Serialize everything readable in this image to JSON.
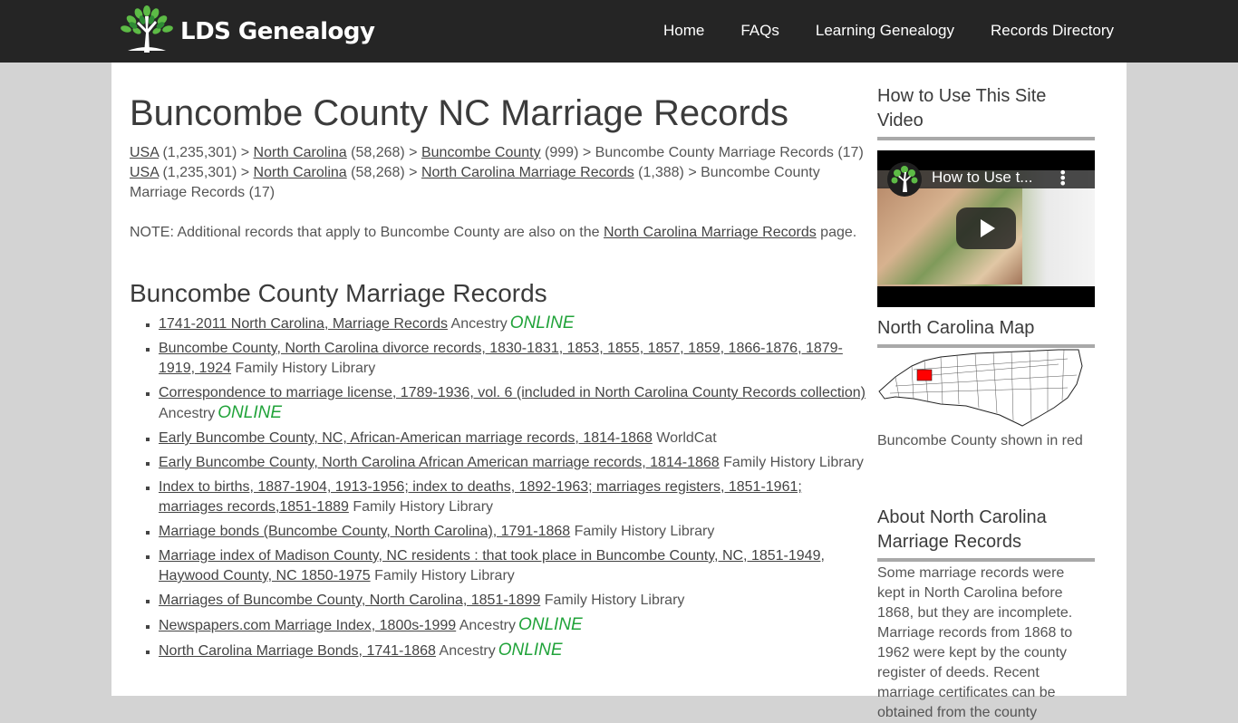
{
  "site": {
    "logo_text": "LDS Genealogy",
    "nav": [
      {
        "label": "Home"
      },
      {
        "label": "FAQs"
      },
      {
        "label": "Learning Genealogy"
      },
      {
        "label": "Records Directory"
      }
    ]
  },
  "main": {
    "title": "Buncombe County NC Marriage Records",
    "breadcrumbs": [
      {
        "items": [
          {
            "link": "USA",
            "count": " (1,235,301) > "
          },
          {
            "link": "North Carolina",
            "count": " (58,268) > "
          },
          {
            "link": "Buncombe County",
            "count": " (999) > Buncombe County Marriage Records (17)"
          }
        ]
      },
      {
        "items": [
          {
            "link": "USA",
            "count": " (1,235,301) > "
          },
          {
            "link": "North Carolina",
            "count": " (58,268) > "
          },
          {
            "link": "North Carolina Marriage Records",
            "count": " (1,388) > Buncombe County Marriage Records (17)"
          }
        ]
      }
    ],
    "note": {
      "prefix": "NOTE: Additional records that apply to Buncombe County are also on the ",
      "link": "North Carolina Marriage Records",
      "suffix": " page."
    },
    "section_title": "Buncombe County Marriage Records",
    "online_label": "ONLINE",
    "records": [
      {
        "title": "1741-2011 North Carolina, Marriage Records",
        "source": "Ancestry",
        "online": true
      },
      {
        "title": "Buncombe County, North Carolina divorce records, 1830-1831, 1853, 1855, 1857, 1859, 1866-1876, 1879-1919, 1924",
        "source": "Family History Library",
        "online": false
      },
      {
        "title": "Correspondence to marriage license, 1789-1936, vol. 6 (included in North Carolina County Records collection)",
        "source": "Ancestry",
        "online": true
      },
      {
        "title": "Early Buncombe County, NC, African-American marriage records, 1814-1868",
        "source": "WorldCat",
        "online": false
      },
      {
        "title": "Early Buncombe County, North Carolina African American marriage records, 1814-1868",
        "source": "Family History Library",
        "online": false
      },
      {
        "title": "Index to births, 1887-1904, 1913-1956; index to deaths, 1892-1963; marriages registers, 1851-1961; marriages records,1851-1889",
        "source": "Family History Library",
        "online": false
      },
      {
        "title": "Marriage bonds (Buncombe County, North Carolina), 1791-1868",
        "source": "Family History Library",
        "online": false
      },
      {
        "title": "Marriage index of Madison County, NC residents : that took place in Buncombe County, NC, 1851-1949, Haywood County, NC 1850-1975",
        "source": "Family History Library",
        "online": false
      },
      {
        "title": "Marriages of Buncombe County, North Carolina, 1851-1899",
        "source": "Family History Library",
        "online": false
      },
      {
        "title": "Newspapers.com Marriage Index, 1800s-1999",
        "source": "Ancestry",
        "online": true
      },
      {
        "title": "North Carolina Marriage Bonds, 1741-1868",
        "source": "Ancestry",
        "online": true
      }
    ]
  },
  "sidebar": {
    "video_heading": "How to Use This Site Video",
    "video_title": "How to Use t...",
    "map_heading": "North Carolina Map",
    "map_caption": "Buncombe County shown in red",
    "highlight_color": "#ff0000",
    "about_heading": "About North Carolina Marriage Records",
    "about_text": "Some marriage records were kept in North Carolina before 1868, but they are incomplete. Marriage records from 1868 to 1962 were kept by the county register of deeds. Recent marriage certificates can be obtained from the county"
  },
  "colors": {
    "header_bg": "#252525",
    "page_bg": "#d3d3d3",
    "online_green": "#21a33a"
  }
}
